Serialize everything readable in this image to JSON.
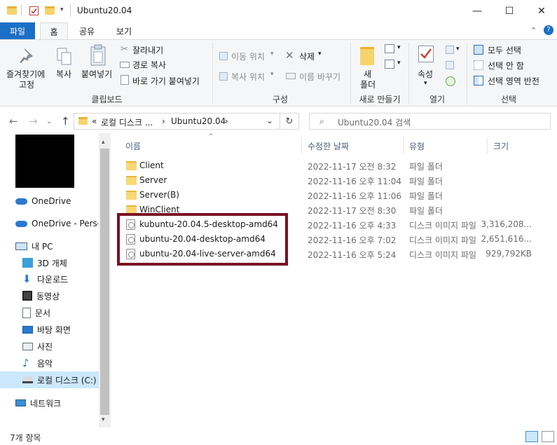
{
  "window": {
    "title": "Ubuntu20.04",
    "min_glyph": "—",
    "max_glyph": "☐",
    "close_glyph": "✕"
  },
  "ribbon_tabs": [
    {
      "label": "파일"
    },
    {
      "label": "홈"
    },
    {
      "label": "공유"
    },
    {
      "label": "보기"
    }
  ],
  "ribbon": {
    "pin_label_1": "즐겨찾기에",
    "pin_label_2": "고정",
    "copy_label": "복사",
    "paste_label": "붙여넣기",
    "cut_label": "잘라내기",
    "copy_path_label": "경로 복사",
    "paste_shortcut_label": "바로 가기 붙여넣기",
    "clipboard_group": "클립보드",
    "move_to_label": "이동 위치",
    "copy_to_label": "복사 위치",
    "delete_label": "삭제",
    "rename_label": "이름 바꾸기",
    "organize_group": "구성",
    "new_folder_label_1": "새",
    "new_folder_label_2": "폴더",
    "new_group": "새로 만들기",
    "properties_label": "속성",
    "open_group": "열기",
    "select_all_label": "모두 선택",
    "select_none_label": "선택 안 함",
    "invert_selection_label": "선택 영역 반전",
    "select_group": "선택"
  },
  "address": {
    "path_prefix": "«",
    "path_parent": "로컬 디스크 ...",
    "path_sep": "›",
    "path_current": "Ubuntu20.04",
    "search_placeholder": "Ubuntu20.04 검색"
  },
  "nav": {
    "items": [
      {
        "label": "OneDrive"
      },
      {
        "label": "OneDrive - Personal"
      },
      {
        "label": "내 PC"
      },
      {
        "label": "3D 개체"
      },
      {
        "label": "다운로드"
      },
      {
        "label": "동영상"
      },
      {
        "label": "문서"
      },
      {
        "label": "바탕 화면"
      },
      {
        "label": "사진"
      },
      {
        "label": "음악"
      },
      {
        "label": "로컬 디스크 (C:)"
      },
      {
        "label": "네트워크"
      }
    ]
  },
  "columns": {
    "name": "이름",
    "date": "수정한 날짜",
    "type": "유형",
    "size": "크기"
  },
  "files": [
    {
      "name": "Client",
      "date": "2022-11-17 오전 8:32",
      "type": "파일 폴더",
      "size": "",
      "kind": "folder"
    },
    {
      "name": "Server",
      "date": "2022-11-16 오후 11:04",
      "type": "파일 폴더",
      "size": "",
      "kind": "folder"
    },
    {
      "name": "Server(B)",
      "date": "2022-11-16 오후 11:06",
      "type": "파일 폴더",
      "size": "",
      "kind": "folder"
    },
    {
      "name": "WinClient",
      "date": "2022-11-17 오전 8:30",
      "type": "파일 폴더",
      "size": "",
      "kind": "folder"
    },
    {
      "name": "kubuntu-20.04.5-desktop-amd64",
      "date": "2022-11-16 오후 4:33",
      "type": "디스크 이미지 파일",
      "size": "3,316,208...",
      "kind": "disc"
    },
    {
      "name": "ubuntu-20.04-desktop-amd64",
      "date": "2022-11-16 오후 7:02",
      "type": "디스크 이미지 파일",
      "size": "2,651,616...",
      "kind": "disc"
    },
    {
      "name": "ubuntu-20.04-live-server-amd64",
      "date": "2022-11-16 오후 5:24",
      "type": "디스크 이미지 파일",
      "size": "929,792KB",
      "kind": "disc"
    }
  ],
  "status": {
    "item_count": "7개 항목"
  },
  "colors": {
    "file_tab": "#1a6fc4",
    "highlight_box": "#7a1023",
    "header_text": "#4c607a"
  }
}
